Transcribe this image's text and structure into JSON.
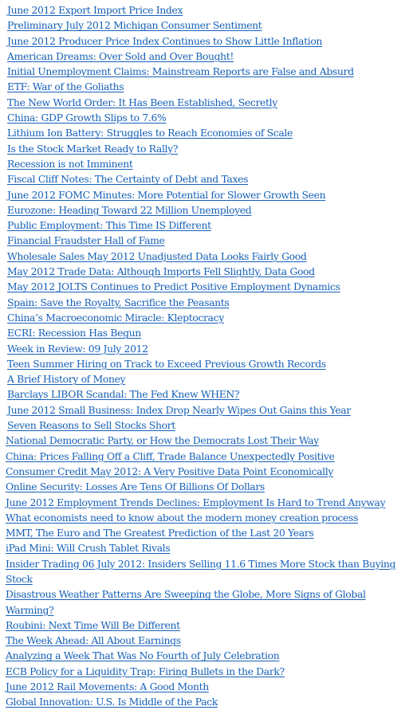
{
  "links_color": "#1560b8",
  "articles": [
    {
      "title": "June 2012 Export Import Price Index"
    },
    {
      "title": "Preliminary July 2012 Michigan Consumer Sentiment"
    },
    {
      "title": "June 2012 Producer Price Index Continues to Show Little Inflation"
    },
    {
      "title": "American Dreams: Over Sold and Over Bought!"
    },
    {
      "title": "Initial Unemployment Claims: Mainstream Reports are False and Absurd"
    },
    {
      "title": "ETF: War of the Goliaths"
    },
    {
      "title": "The New World Order: It Has Been Established, Secretly"
    },
    {
      "title": "China: GDP Growth Slips to 7.6%"
    },
    {
      "title": "Lithium Ion Battery: Struggles to Reach Economies of Scale"
    },
    {
      "title": "Is the Stock Market Ready to Rally?"
    },
    {
      "title": "Recession is not Imminent"
    },
    {
      "title": "Fiscal Cliff Notes: The Certainty of Debt and Taxes"
    },
    {
      "title": "June 2012 FOMC Minutes: More Potential for Slower Growth Seen"
    },
    {
      "title": "Eurozone: Heading Toward 22 Million Unemployed"
    },
    {
      "title": "Public Employment: This Time IS Different"
    },
    {
      "title": "Financial Fraudster Hall of Fame"
    },
    {
      "title": "Wholesale Sales May 2012 Unadjusted Data Looks Fairly Good"
    },
    {
      "title": "May 2012 Trade Data: Although Imports Fell Slightly, Data Good"
    },
    {
      "title": "May 2012 JOLTS Continues to Predict Positive Employment Dynamics"
    },
    {
      "title": "Spain: Save the Royalty, Sacrifice the Peasants"
    },
    {
      "title": "China’s Macroeconomic Miracle: Kleptocracy"
    },
    {
      "title": "ECRI: Recession Has Begun"
    },
    {
      "title": "Week in Review: 09 July 2012"
    },
    {
      "title": "Teen Summer Hiring on Track to Exceed Previous Growth Records"
    },
    {
      "title": "A Brief History of Money"
    },
    {
      "title": "Barclays LIBOR Scandal: The Fed Knew WHEN?"
    },
    {
      "title": "June 2012 Small Business: Index Drop Nearly Wipes Out Gains this Year"
    },
    {
      "title": "Seven Reasons to Sell Stocks Short"
    },
    {
      "title": "National Democratic Party, or How the Democrats Lost Their Way"
    },
    {
      "title": "China: Prices Falling Off a Cliff, Trade Balance Unexpectedly Positive"
    },
    {
      "title": "Consumer Credit May 2012: A Very Positive Data Point Economically"
    },
    {
      "title": "Online Security: Losses Are Tens Of Billions Of Dollars"
    },
    {
      "title": "June 2012 Employment Trends Declines: Employment Is Hard to Trend Anyway"
    },
    {
      "title": "What economists need to know about the modern money creation process"
    },
    {
      "title": "MMT, The Euro and The Greatest Prediction of the Last 20 Years"
    },
    {
      "title": "iPad Mini: Will Crush Tablet Rivals"
    },
    {
      "title": "Insider Trading 06 July 2012: Insiders Selling 11.6 Times More Stock than Buying Stock"
    },
    {
      "title": "Disastrous Weather Patterns Are Sweeping the Globe, More Signs of Global Warming?"
    },
    {
      "title": "Roubini: Next Time Will Be Different"
    },
    {
      "title": "The Week Ahead: All About Earnings"
    },
    {
      "title": "Analyzing a Week That Was No Fourth of July Celebration"
    },
    {
      "title": "ECB Policy for a Liquidity Trap: Firing Bullets in the Dark?"
    },
    {
      "title": "June 2012 Rail Movements: A Good Month"
    },
    {
      "title": "Global Innovation: U.S. Is Middle of the Pack"
    }
  ]
}
